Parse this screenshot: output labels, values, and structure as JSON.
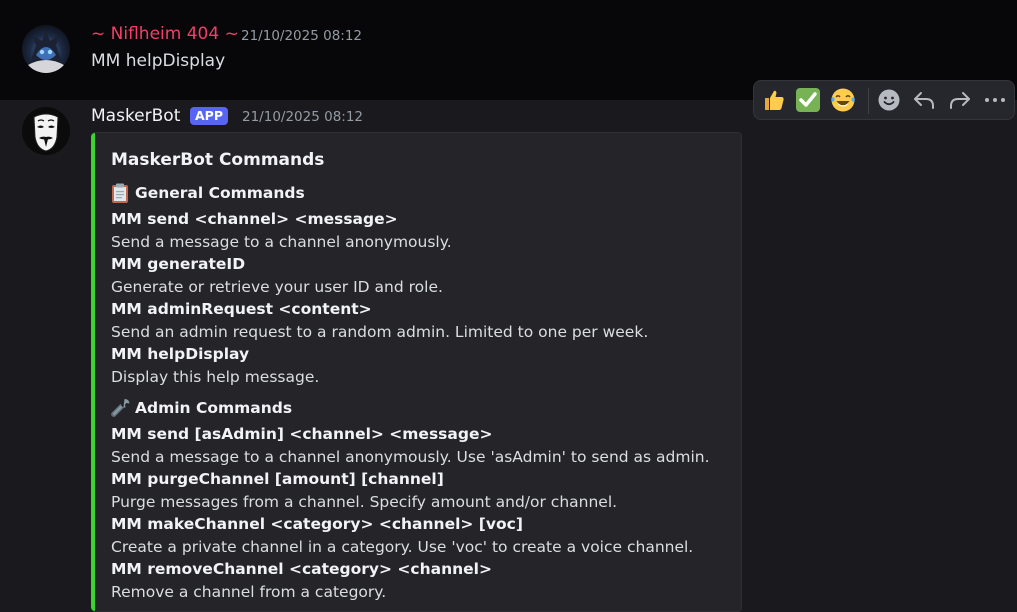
{
  "messages": [
    {
      "author": "~ Niflheim 404 ~",
      "author_color": "#f23f6a",
      "timestamp": "21/10/2025 08:12",
      "content": "MM helpDisplay",
      "avatar_icon": "dragon-avatar-icon"
    },
    {
      "author": "MaskerBot",
      "author_color": "#f2f3f5",
      "badge": "APP",
      "timestamp": "21/10/2025 08:12",
      "avatar_icon": "anonymous-mask-avatar-icon",
      "embed": {
        "accent_color": "#3ad52e",
        "title": "MaskerBot Commands",
        "sections": [
          {
            "icon": "clipboard-icon",
            "heading": "General Commands",
            "commands": [
              {
                "name": "MM send <channel> <message>",
                "desc": "Send a message to a channel anonymously."
              },
              {
                "name": "MM generateID",
                "desc": "Generate or retrieve your user ID and role."
              },
              {
                "name": "MM adminRequest <content>",
                "desc": "Send an admin request to a random admin. Limited to one per week."
              },
              {
                "name": "MM helpDisplay",
                "desc": "Display this help message."
              }
            ]
          },
          {
            "icon": "wrench-icon",
            "heading": "Admin Commands",
            "commands": [
              {
                "name": "MM send [asAdmin] <channel> <message>",
                "desc": "Send a message to a channel anonymously. Use 'asAdmin' to send as admin."
              },
              {
                "name": "MM purgeChannel [amount] [channel]",
                "desc": "Purge messages from a channel. Specify amount and/or channel."
              },
              {
                "name": "MM makeChannel <category> <channel> [voc]",
                "desc": "Create a private channel in a category. Use 'voc' to create a voice channel."
              },
              {
                "name": "MM removeChannel <category> <channel>",
                "desc": "Remove a channel from a category."
              }
            ]
          }
        ]
      }
    }
  ],
  "toolbar": {
    "items": [
      "thumbs-up-icon",
      "check-mark-icon",
      "laughing-tears-icon",
      "add-reaction-icon",
      "reply-icon",
      "forward-icon",
      "more-icon"
    ]
  }
}
